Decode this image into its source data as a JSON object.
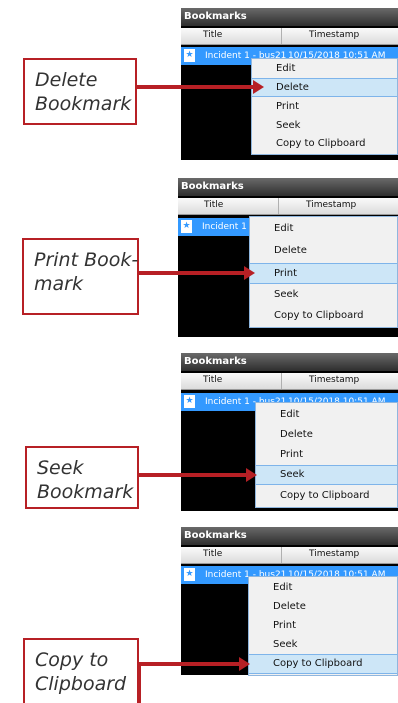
{
  "panel_title": "Bookmarks",
  "columns": {
    "title": "Title",
    "timestamp": "Timestamp"
  },
  "row": {
    "title": "Incident 1 - bus21",
    "timestamp": "10/15/2018 10:51 AM"
  },
  "menu_items": [
    "Edit",
    "Delete",
    "Print",
    "Seek",
    "Copy to Clipboard"
  ],
  "steps": [
    {
      "caption": [
        "Delete",
        "Bookmark"
      ],
      "selected": "Delete"
    },
    {
      "caption": [
        "Print Book-",
        "mark"
      ],
      "selected": "Print"
    },
    {
      "caption": [
        "Seek",
        "Bookmark"
      ],
      "selected": "Seek"
    },
    {
      "caption": [
        "Copy to",
        "Clipboard"
      ],
      "selected": "Copy to Clipboard"
    }
  ],
  "colors": {
    "accent": "#b72025",
    "selection": "#3399ff",
    "menu_highlight": "#cde6f7"
  },
  "icons": {
    "bookmark": "bookmark-star-icon"
  }
}
